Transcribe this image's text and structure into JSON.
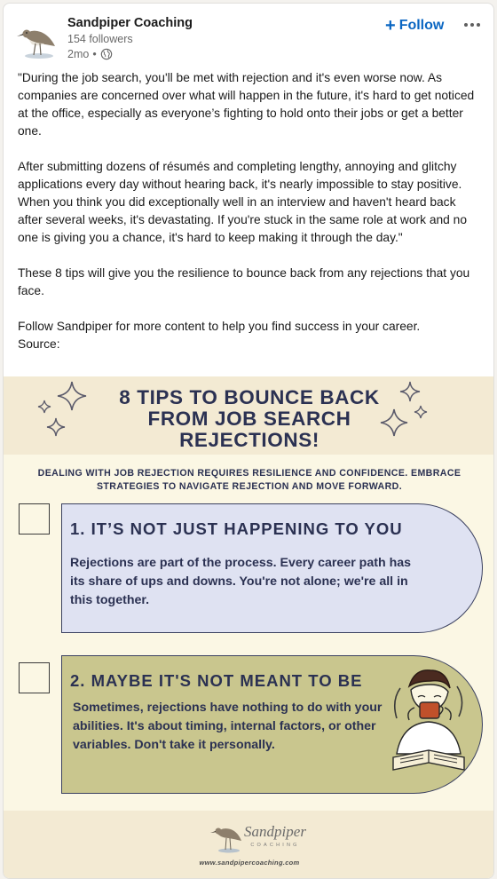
{
  "post": {
    "author": {
      "name": "Sandpiper Coaching",
      "followers": "154 followers",
      "time": "2mo",
      "separator": "•",
      "visibility_icon": "globe-icon"
    },
    "follow_label": "Follow",
    "more_icon": "more-horizontal-icon",
    "paragraphs": [
      "\"During the job search, you'll be met with rejection and it's even worse now. As companies are concerned over what will happen in the future, it's hard to get noticed at the office, especially as everyone’s fighting to hold onto their jobs or get a better one.",
      "After submitting dozens of résumés and completing lengthy, annoying and glitchy applications every day without hearing back, it's nearly impossible to stay positive. When you think you did exceptionally well in an interview and haven't heard back after several weeks, it's devastating. If you're stuck in the same role at work and no one is giving you a chance, it's hard to keep making it through the day.\"",
      "These 8 tips will give you the resilience to bounce back from any rejections that you face.",
      "Follow Sandpiper for more content to help you find success in your career.",
      "Source:"
    ]
  },
  "infographic": {
    "title": "8 TIPS TO BOUNCE BACK FROM JOB SEARCH REJECTIONS!",
    "subtitle": "DEALING WITH JOB REJECTION REQUIRES RESILIENCE AND CONFIDENCE. EMBRACE STRATEGIES TO NAVIGATE REJECTION AND MOVE FORWARD.",
    "tips": [
      {
        "heading": "1. IT’S NOT JUST HAPPENING TO YOU",
        "body": "Rejections are part of the process. Every career path has its share of ups and downs. You're not alone; we're all in this together."
      },
      {
        "heading": "2. MAYBE IT'S NOT MEANT TO BE",
        "body": "Sometimes, rejections have nothing to do with your abilities. It's about timing, internal factors, or other variables. Don't take it personally."
      }
    ],
    "brand": {
      "name": "Sandpiper",
      "tagline": "COACHING",
      "url": "www.sandpipercoaching.com"
    },
    "colors": {
      "navy": "#2b3152",
      "tip1_bg": "#dfe2f2",
      "tip2_bg": "#c9c68e",
      "cream": "#fbf7e4",
      "band": "#f3ead3"
    }
  },
  "colors": {
    "link_blue": "#0a66c2"
  }
}
